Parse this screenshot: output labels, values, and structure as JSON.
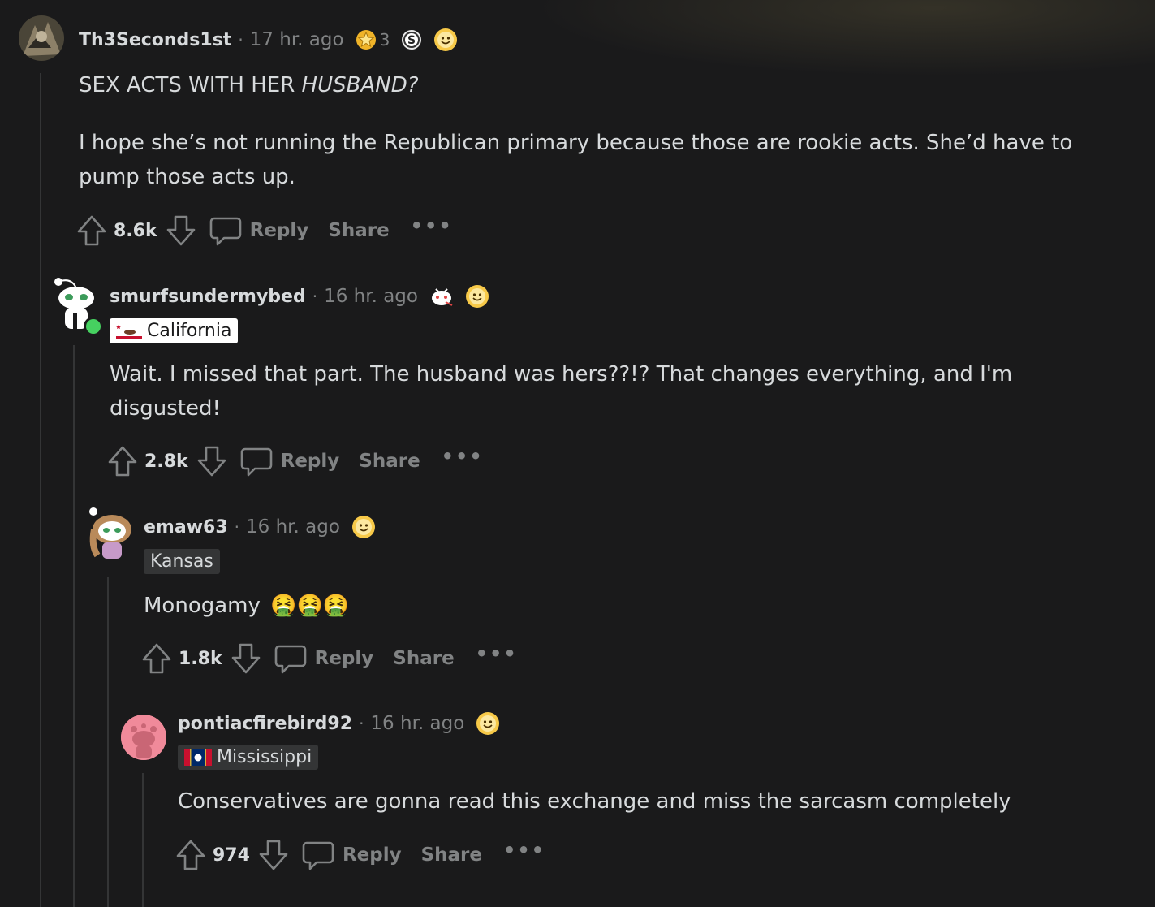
{
  "comments": [
    {
      "username": "Th3Seconds1st",
      "time": "17 hr. ago",
      "award_count": "3",
      "body": {
        "line1_prefix": "SEX ACTS WITH HER ",
        "line1_emph": "HUSBAND?",
        "line2": "I hope she’s not running the Republican primary because those are rookie acts. She’d have to",
        "line3": "pump those acts up."
      },
      "score": "8.6k",
      "reply": "Reply",
      "share": "Share",
      "more": "•••"
    },
    {
      "username": "smurfsundermybed",
      "time": "16 hr. ago",
      "flair": "California",
      "body": {
        "line1": "Wait. I missed that part. The husband was hers??!? That changes everything, and I'm",
        "line2": "disgusted!"
      },
      "score": "2.8k",
      "reply": "Reply",
      "share": "Share",
      "more": "•••"
    },
    {
      "username": "emaw63",
      "time": "16 hr. ago",
      "flair": "Kansas",
      "body": {
        "line1": "Monogamy",
        "emoji": "🤮🤮🤮"
      },
      "score": "1.8k",
      "reply": "Reply",
      "share": "Share",
      "more": "•••"
    },
    {
      "username": "pontiacfirebird92",
      "time": "16 hr. ago",
      "flair": "Mississippi",
      "body": {
        "line1": "Conservatives are gonna read this exchange and miss the sarcasm completely"
      },
      "score": "974",
      "reply": "Reply",
      "share": "Share",
      "more": "•••"
    }
  ],
  "colors": {
    "background": "#1a1a1b",
    "text": "#d7dadc",
    "muted": "#818384",
    "thread_line": "#343536",
    "online": "#46d160"
  },
  "icons": [
    "upvote-icon",
    "downvote-icon",
    "comment-icon",
    "gold-award-icon",
    "silver-award-icon",
    "wholesome-award-icon",
    "snoo-award-icon"
  ]
}
